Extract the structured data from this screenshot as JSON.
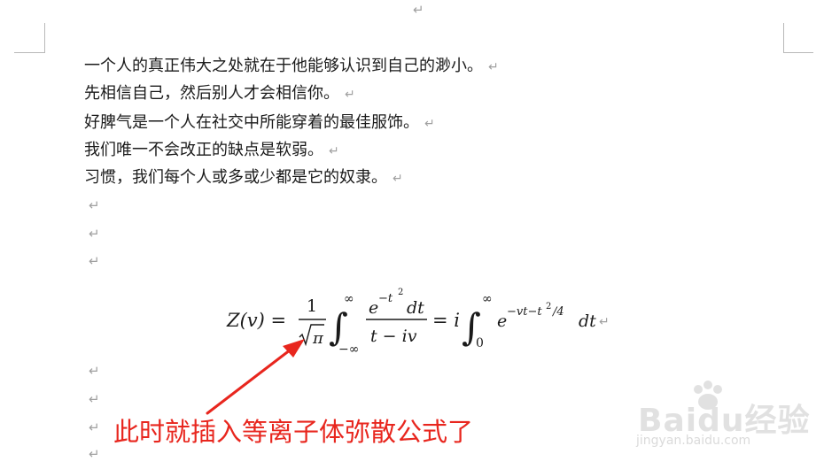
{
  "document": {
    "top_mark": "↵",
    "paragraph_mark": "↵",
    "lines": [
      "一个人的真正伟大之处就在于他能够认识到自己的渺小。",
      "先相信自己，然后别人才会相信你。",
      "好脾气是一个人在社交中所能穿着的最佳服饰。",
      "我们唯一不会改正的缺点是软弱。",
      "习惯，我们每个人或多或少都是它的奴隶。"
    ]
  },
  "formula": {
    "lhs": "Z(v) =",
    "frac_num": "1",
    "sqrt_arg": "π",
    "int_upper": "∞",
    "int_lower": "−∞",
    "exp_base": "e",
    "exp_power": "−t",
    "exp_power_sq": "2",
    "dt": "dt",
    "denominator": "t − iv",
    "eq_i": "= i",
    "int2_upper": "∞",
    "int2_lower": "0",
    "exp2_base": "e",
    "exp2_power": "−vt−t",
    "exp2_power_sq": "2",
    "exp2_div": "/4",
    "dt2": "dt",
    "end_mark": "↵"
  },
  "annotation": {
    "caption": "此时就插入等离子体弥散公式了",
    "color": "#e8261e"
  },
  "watermark": {
    "main": "Baidu经验",
    "sub": "jingyan.baidu.com"
  }
}
